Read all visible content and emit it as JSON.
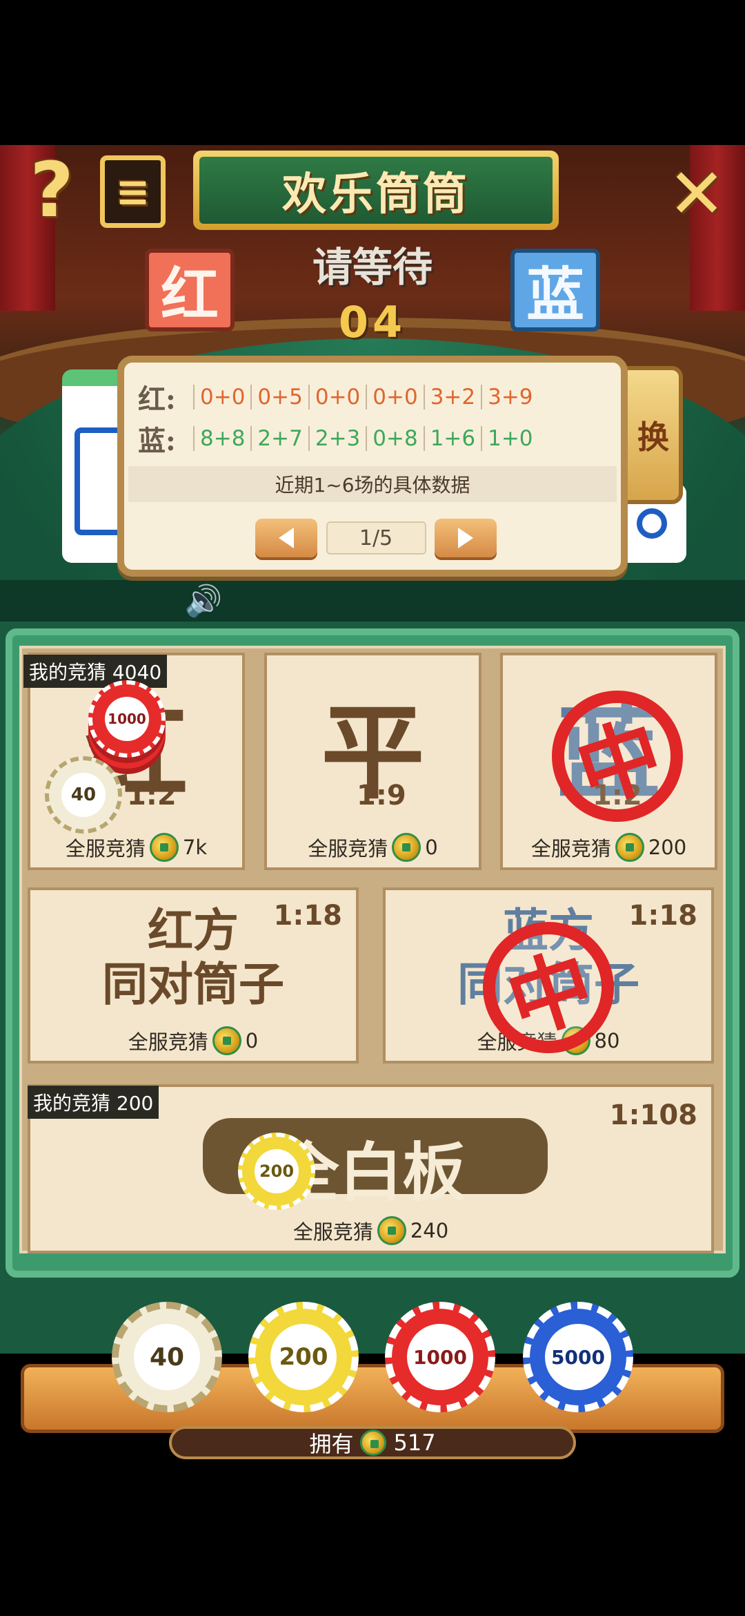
{
  "header": {
    "title": "欢乐筒筒",
    "status": "请等待",
    "countdown": "04",
    "red_label": "红",
    "blue_label": "蓝",
    "swap_label": "换"
  },
  "records": {
    "red_label": "红:",
    "blue_label": "蓝:",
    "red": [
      "0+0",
      "0+5",
      "0+0",
      "0+0",
      "3+2",
      "3+9"
    ],
    "blue": [
      "8+8",
      "2+7",
      "2+3",
      "0+8",
      "1+6",
      "1+0"
    ],
    "caption": "近期1~6场的具体数据",
    "page": "1/5"
  },
  "board": {
    "total_label": "全服竞猜",
    "cells": [
      {
        "name": "红",
        "odds": "1:2",
        "total": "7k",
        "my_bet": "4040",
        "settled": false
      },
      {
        "name": "平",
        "odds": "1:9",
        "total": "0",
        "settled": false
      },
      {
        "name": "蓝",
        "odds": "1:2",
        "total": "200",
        "settled": true
      },
      {
        "name_line1": "红方",
        "name_line2": "同对筒子",
        "odds": "1:18",
        "total": "0",
        "settled": false
      },
      {
        "name_line1": "蓝方",
        "name_line2": "同对筒子",
        "odds": "1:18",
        "total": "80",
        "settled": true
      },
      {
        "name": "全白板",
        "odds": "1:108",
        "total": "240",
        "my_bet": "200",
        "settled": false
      }
    ],
    "my_bet_label": "我的竞猜",
    "stamp_char": "中"
  },
  "placed_chips": {
    "red_stack": "1000",
    "red_single": "40",
    "white_board": "200"
  },
  "chip_selector": [
    {
      "value": "40",
      "color": "#f2ecd6"
    },
    {
      "value": "200",
      "color": "#f2d83a"
    },
    {
      "value": "1000",
      "color": "#e62b2b"
    },
    {
      "value": "5000",
      "color": "#2a5fd6"
    }
  ],
  "balance": {
    "label": "拥有",
    "value": "517"
  },
  "colors": {
    "felt": "#1a5b40",
    "red_team": "#f07058",
    "blue_team": "#5ea6e6",
    "stamp": "#e02626"
  }
}
